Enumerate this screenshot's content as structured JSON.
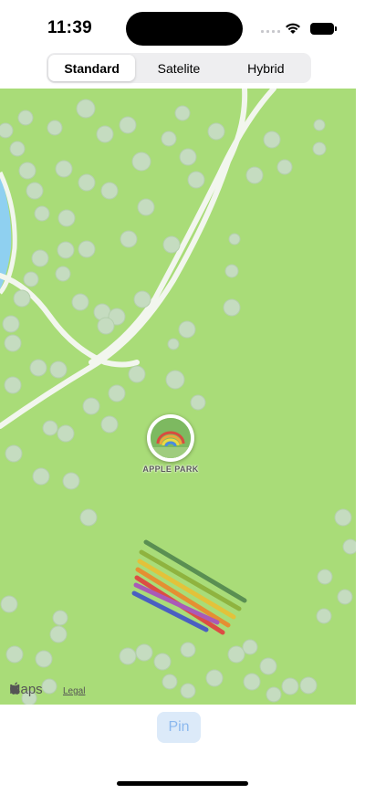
{
  "status_bar": {
    "time": "11:39",
    "signal_icon": "cellular-signal-icon",
    "wifi_icon": "wifi-icon",
    "battery_icon": "battery-icon"
  },
  "map_type_control": {
    "segments": [
      {
        "label": "Standard",
        "selected": true
      },
      {
        "label": "Satelite",
        "selected": false
      },
      {
        "label": "Hybrid",
        "selected": false
      }
    ]
  },
  "map": {
    "poi": {
      "label": "APPLE PARK",
      "icon": "apple-park-rainbow-icon"
    },
    "attribution": {
      "logo_text": "Maps",
      "legal": "Legal",
      "logo_icon": "apple-logo-icon"
    },
    "colors": {
      "grass": "#a9dc78",
      "road": "#f2f6ee",
      "water": "#8fd0f0"
    }
  },
  "pin_button": {
    "label": "Pin",
    "color": "#8bb8ee"
  }
}
